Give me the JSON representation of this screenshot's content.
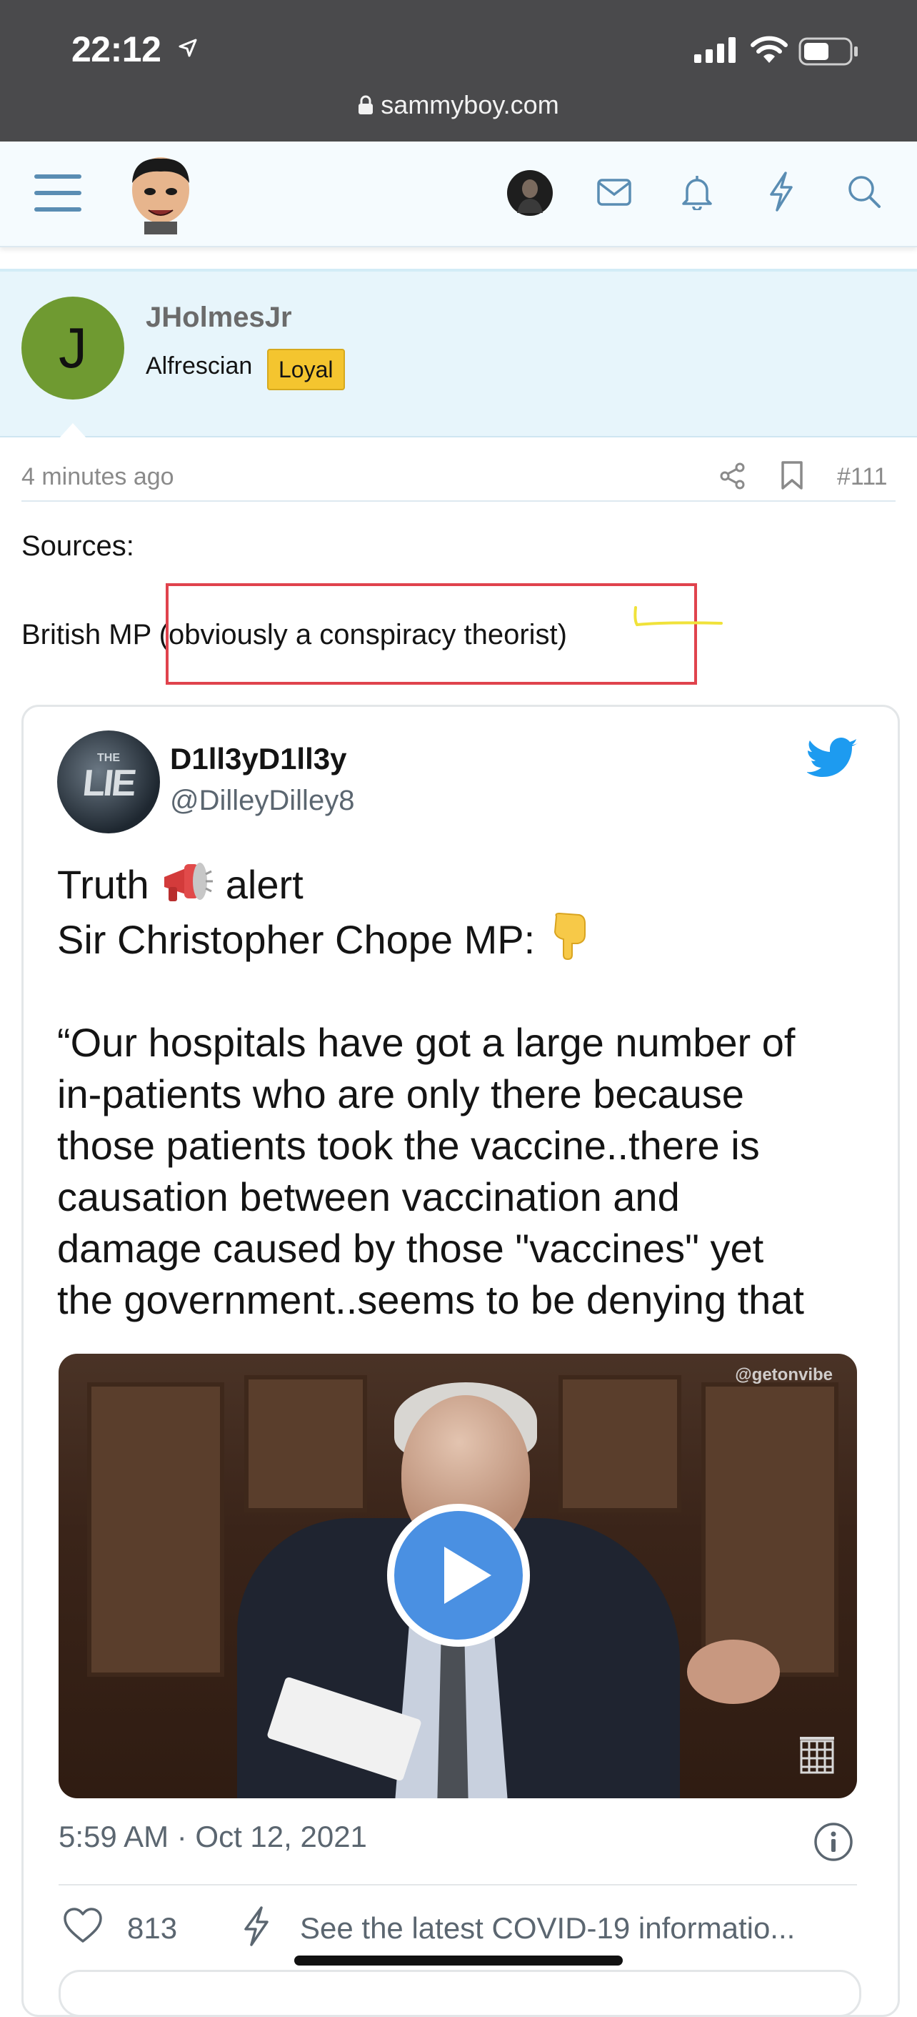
{
  "status_bar": {
    "time": "22:12",
    "url": "sammyboy.com"
  },
  "header": {
    "icons": [
      "menu-icon",
      "site-logo",
      "user-avatar",
      "mail-icon",
      "bell-icon",
      "bolt-icon",
      "search-icon"
    ],
    "accent_color": "#5a8db3"
  },
  "post": {
    "avatar_letter": "J",
    "username": "JHolmesJr",
    "user_title": "Alfrescian",
    "badge": "Loyal",
    "time_ago": "4 minutes ago",
    "post_number": "#111",
    "sources_label": "Sources:",
    "body_prefix": "British MP",
    "body_highlight": " (obviously a conspiracy theorist)"
  },
  "tweet": {
    "display_name": "D1ll3yD1ll3y",
    "handle": "@DilleyDilley8",
    "avatar_text_the": "THE",
    "avatar_text_lie": "LIE",
    "line1_a": "Truth ",
    "line1_b": " alert",
    "line2": "Sir Christopher Chope MP: ",
    "quote_lines": [
      "“Our hospitals have got a large number of",
      "in-patients who are only there because",
      "those patients took the vaccine..there is",
      "causation between vaccination and",
      "damage caused by those \"vaccines\" yet",
      "the government..seems to be denying that"
    ],
    "video_watermark": "@getonvibe",
    "date": "5:59 AM · Oct 12, 2021",
    "likes": "813",
    "covid_link": "See the latest COVID-19 informatio..."
  }
}
